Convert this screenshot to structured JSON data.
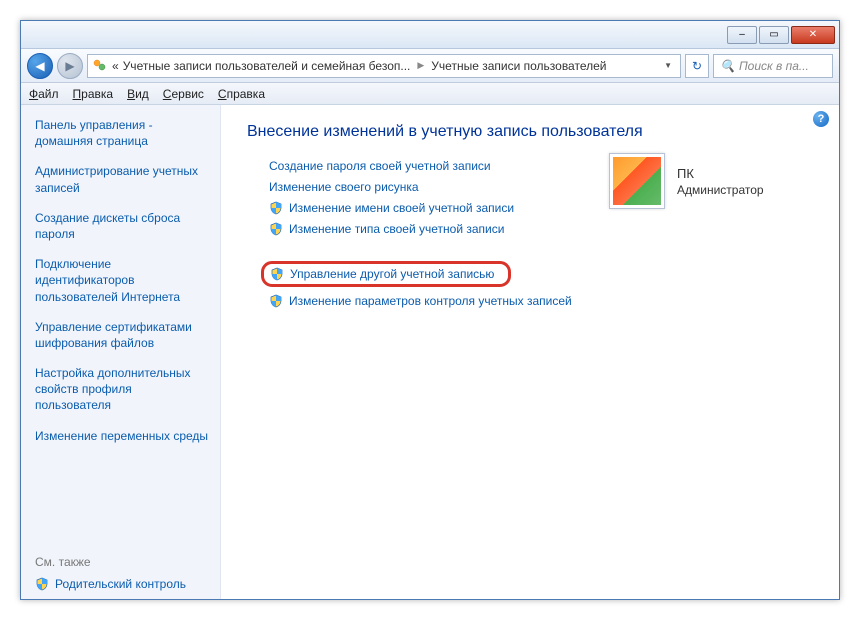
{
  "titlebar": {
    "min": "–",
    "max": "▭",
    "close": "✕"
  },
  "nav": {
    "back": "◀",
    "fwd": "▶"
  },
  "address": {
    "prefix": "«",
    "part1": "Учетные записи пользователей и семейная безоп...",
    "part2": "Учетные записи пользователей"
  },
  "refresh": "↻",
  "search": {
    "icon": "🔍",
    "placeholder": "Поиск в па..."
  },
  "menu": {
    "file": "Файл",
    "edit": "Правка",
    "view": "Вид",
    "tools": "Сервис",
    "help": "Справка"
  },
  "sidebar": {
    "items": [
      "Панель управления - домашняя страница",
      "Администрирование учетных записей",
      "Создание дискеты сброса пароля",
      "Подключение идентификаторов пользователей Интернета",
      "Управление сертификатами шифрования файлов",
      "Настройка дополнительных свойств профиля пользователя",
      "Изменение переменных среды"
    ],
    "seealso": "См. также",
    "parental": "Родительский контроль"
  },
  "main": {
    "title": "Внесение изменений в учетную запись пользователя",
    "links": {
      "l1": "Создание пароля своей учетной записи",
      "l2": "Изменение своего рисунка",
      "l3": "Изменение имени своей учетной записи",
      "l4": "Изменение типа своей учетной записи",
      "l5": "Управление другой учетной записью",
      "l6": "Изменение параметров контроля учетных записей"
    }
  },
  "account": {
    "name": "ПК",
    "role": "Администратор"
  },
  "help": "?"
}
